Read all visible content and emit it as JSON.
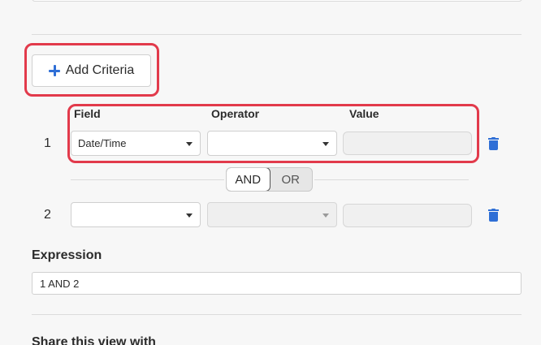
{
  "add_criteria": {
    "label": "Add Criteria"
  },
  "columns": {
    "field": "Field",
    "operator": "Operator",
    "value": "Value"
  },
  "rows": [
    {
      "number": "1",
      "field": "Date/Time",
      "operator": "",
      "value": ""
    },
    {
      "number": "2",
      "field": "",
      "operator": "",
      "value": ""
    }
  ],
  "logic_toggle": {
    "and": "AND",
    "or": "OR",
    "selected": "AND"
  },
  "expression": {
    "label": "Expression",
    "value": "1 AND 2"
  },
  "share": {
    "label": "Share this view with"
  },
  "colors": {
    "accent": "#2f6fd6",
    "highlight": "#e23a4b"
  },
  "icons": {
    "add": "plus-icon",
    "delete": "trash-icon",
    "dropdown": "chevron-down-icon"
  }
}
